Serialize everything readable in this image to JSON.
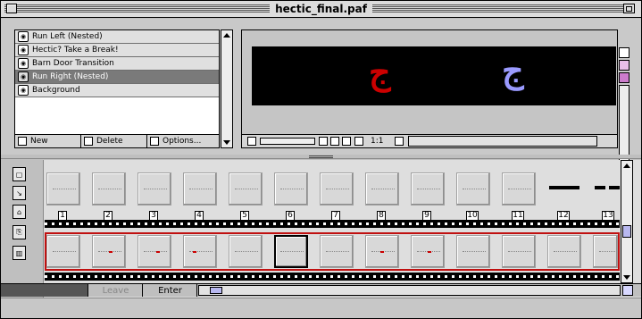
{
  "window": {
    "title": "hectic_final.paf"
  },
  "layers": [
    {
      "name": "Run Left (Nested)",
      "selected": false
    },
    {
      "name": "Hectic? Take a Break!",
      "selected": false
    },
    {
      "name": "Barn Door Transition",
      "selected": false
    },
    {
      "name": "Run Right (Nested)",
      "selected": true
    },
    {
      "name": "Background",
      "selected": false
    }
  ],
  "layer_buttons": {
    "new": "New",
    "delete": "Delete",
    "options": "Options..."
  },
  "preview": {
    "zoom": "1:1",
    "glyph_left_color": "#cc0000",
    "glyph_right_color": "#9a9aff"
  },
  "timeline": {
    "frame_numbers": [
      "1",
      "2",
      "3",
      "4",
      "5",
      "6",
      "7",
      "8",
      "9",
      "10",
      "11",
      "12",
      "13"
    ],
    "current_frame": "6",
    "selected_track_color": "#c01010"
  },
  "bottom": {
    "leave": "Leave",
    "enter": "Enter"
  }
}
